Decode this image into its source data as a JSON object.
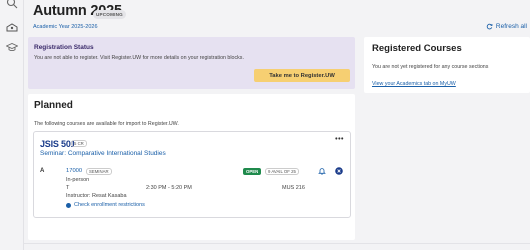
{
  "header": {
    "title": "Autumn 2025",
    "badge": "UPCOMING",
    "academic_year": "Academic Year 2025-2026",
    "refresh_label": "Refresh all"
  },
  "registration_status": {
    "heading": "Registration Status",
    "message": "You are not able to register. Visit Register.UW for more details on your registration blocks.",
    "button_label": "Take me to Register.UW"
  },
  "registered_courses": {
    "heading": "Registered Courses",
    "message": "You are not yet registered for any course sections",
    "link": "View your Academics tab on MyUW"
  },
  "planned": {
    "heading": "Planned",
    "message": "The following courses are available for import to Register.UW.",
    "course": {
      "code": "JSIS 501",
      "credits": "5 CR",
      "name": "Seminar: Comparative International Studies",
      "more": "•••",
      "section": {
        "id": "A",
        "sln": "17000",
        "type": "SEMINAR",
        "status": "OPEN",
        "availability": "9 AVAIL OF 25",
        "mode": "In-person",
        "days": "T",
        "time": "2:30 PM - 5:20 PM",
        "room": "MUS 216",
        "instructor": "Instructor: Resat Kasaba",
        "restrictions_link": "Check enrollment restrictions"
      }
    }
  },
  "icons": {
    "rail": [
      "search-icon",
      "classroom-icon",
      "graduation-cap-icon"
    ],
    "refresh": "refresh-icon",
    "bell": "bell-icon",
    "remove": "close-circle-icon"
  },
  "colors": {
    "link": "#1a5fa8",
    "status_bg": "#e6e1f1",
    "button": "#f6cf72",
    "open": "#1f8a4c",
    "remove": "#1a3b8a"
  }
}
